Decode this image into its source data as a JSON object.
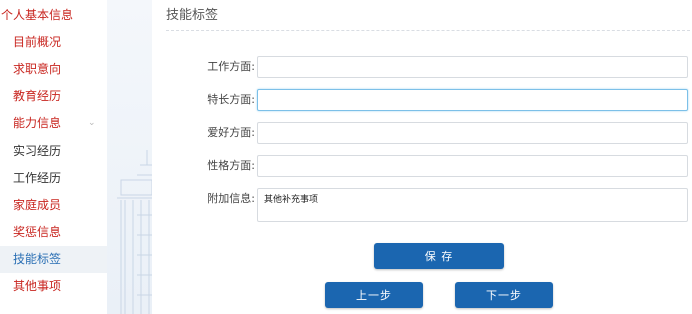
{
  "sidebar": {
    "items": [
      {
        "label": "个人基本信息"
      },
      {
        "label": "目前概况"
      },
      {
        "label": "求职意向"
      },
      {
        "label": "教育经历"
      },
      {
        "label": "能力信息"
      },
      {
        "label": "实习经历"
      },
      {
        "label": "工作经历"
      },
      {
        "label": "家庭成员"
      },
      {
        "label": "奖惩信息"
      },
      {
        "label": "技能标签"
      },
      {
        "label": "其他事项"
      }
    ],
    "expand_icon": "chevron-down-icon"
  },
  "main": {
    "title": "技能标签",
    "fields": [
      {
        "label": "工作方面:",
        "value": ""
      },
      {
        "label": "特长方面:",
        "value": ""
      },
      {
        "label": "爱好方面:",
        "value": ""
      },
      {
        "label": "性格方面:",
        "value": ""
      }
    ],
    "extra": {
      "label": "附加信息:",
      "value": "其他补充事项"
    },
    "buttons": {
      "save": "保 存",
      "prev": "上一步",
      "next": "下一步"
    }
  },
  "colors": {
    "accent": "#1b66b0",
    "nav_red": "#c8251f",
    "active_bg": "#eef2f6"
  }
}
